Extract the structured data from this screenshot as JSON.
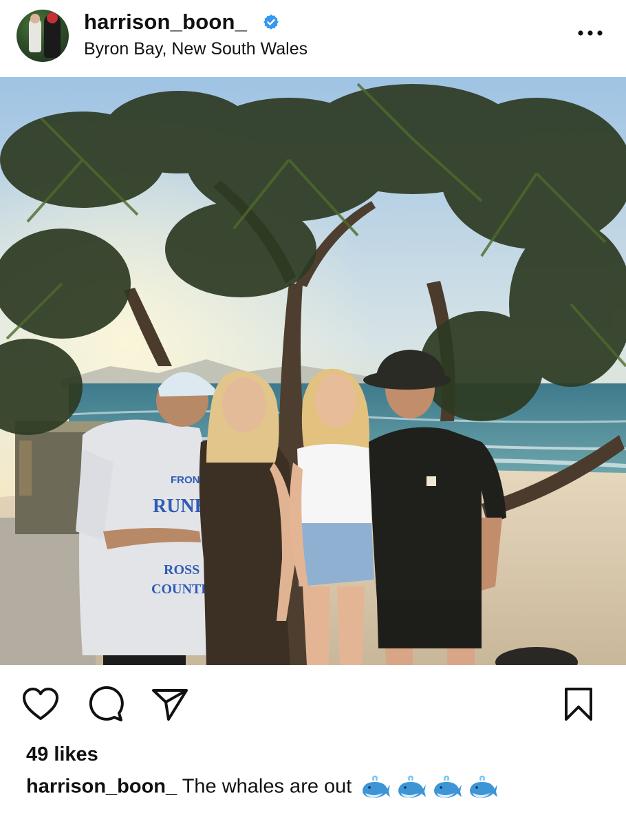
{
  "post": {
    "username": "harrison_boon_",
    "location": "Byron Bay, New South Wales",
    "verified": true,
    "likes_text": "49 likes",
    "caption_user": "harrison_boon_",
    "caption_text": "The whales are out",
    "caption_emojis": [
      "whale-emoji",
      "whale-emoji",
      "whale-emoji",
      "whale-emoji"
    ]
  },
  "icons": {
    "verified": "verified-badge-icon",
    "more": "more-options-icon",
    "like": "heart-icon",
    "comment": "comment-icon",
    "share": "paper-plane-icon",
    "save": "bookmark-icon"
  },
  "colors": {
    "verified_blue": "#3897f0",
    "text": "#111111"
  }
}
